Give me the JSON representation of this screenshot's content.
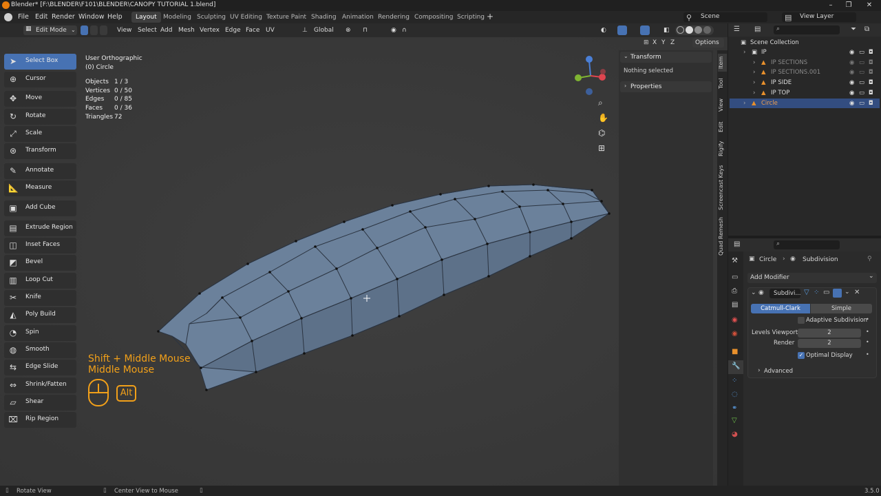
{
  "window": {
    "title": "Blender* [F:\\BLENDER\\F101\\BLENDER\\CANOPY TUTORIAL 1.blend]",
    "minimize": "–",
    "maximize": "❐",
    "close": "✕"
  },
  "menu": [
    "File",
    "Edit",
    "Render",
    "Window",
    "Help"
  ],
  "workspaces": [
    "Layout",
    "Modeling",
    "Sculpting",
    "UV Editing",
    "Texture Paint",
    "Shading",
    "Animation",
    "Rendering",
    "Compositing",
    "Scripting"
  ],
  "add_workspace": "+",
  "scene": {
    "name": "Scene",
    "view_layer": "View Layer"
  },
  "header": {
    "mode": "Edit Mode",
    "menus": [
      "View",
      "Select",
      "Add",
      "Mesh",
      "Vertex",
      "Edge",
      "Face",
      "UV"
    ],
    "orientation": "Global",
    "options": "Options",
    "axes": [
      "X",
      "Y",
      "Z"
    ]
  },
  "toolbar": [
    {
      "label": "Select Box",
      "icon": "select-box-icon",
      "glyph": "➤",
      "active": true
    },
    {
      "label": "Cursor",
      "icon": "cursor-icon",
      "glyph": "⊕"
    },
    {
      "label": "Move",
      "icon": "move-icon",
      "glyph": "✥"
    },
    {
      "label": "Rotate",
      "icon": "rotate-icon",
      "glyph": "↻"
    },
    {
      "label": "Scale",
      "icon": "scale-icon",
      "glyph": "⤢"
    },
    {
      "label": "Transform",
      "icon": "transform-icon",
      "glyph": "⊛"
    },
    {
      "label": "Annotate",
      "icon": "annotate-icon",
      "glyph": "✎"
    },
    {
      "label": "Measure",
      "icon": "measure-icon",
      "glyph": "📐"
    },
    {
      "label": "Add Cube",
      "icon": "add-cube-icon",
      "glyph": "▣"
    },
    {
      "label": "Extrude Region",
      "icon": "extrude-region-icon",
      "glyph": "▤"
    },
    {
      "label": "Inset Faces",
      "icon": "inset-faces-icon",
      "glyph": "◫"
    },
    {
      "label": "Bevel",
      "icon": "bevel-icon",
      "glyph": "◩"
    },
    {
      "label": "Loop Cut",
      "icon": "loop-cut-icon",
      "glyph": "▥"
    },
    {
      "label": "Knife",
      "icon": "knife-icon",
      "glyph": "✂"
    },
    {
      "label": "Poly Build",
      "icon": "poly-build-icon",
      "glyph": "◭"
    },
    {
      "label": "Spin",
      "icon": "spin-icon",
      "glyph": "◔"
    },
    {
      "label": "Smooth",
      "icon": "smooth-icon",
      "glyph": "◍"
    },
    {
      "label": "Edge Slide",
      "icon": "edge-slide-icon",
      "glyph": "⇆"
    },
    {
      "label": "Shrink/Fatten",
      "icon": "shrink-fatten-icon",
      "glyph": "⇔"
    },
    {
      "label": "Shear",
      "icon": "shear-icon",
      "glyph": "▱"
    },
    {
      "label": "Rip Region",
      "icon": "rip-region-icon",
      "glyph": "⌧"
    }
  ],
  "viewport": {
    "view_name": "User Orthographic",
    "object_name": "(0) Circle",
    "stats": [
      {
        "label": "Objects",
        "value": "1 / 3"
      },
      {
        "label": "Vertices",
        "value": "0 / 50"
      },
      {
        "label": "Edges",
        "value": "0 / 85"
      },
      {
        "label": "Faces",
        "value": "0 / 36"
      },
      {
        "label": "Triangles",
        "value": "72"
      }
    ],
    "shortcut_line1": "Shift + Middle Mouse",
    "shortcut_line2": "Middle Mouse",
    "alt_key": "Alt"
  },
  "npanel": {
    "transform": "Transform",
    "nothing_selected": "Nothing selected",
    "properties": "Properties",
    "tabs": [
      "Item",
      "Tool",
      "View",
      "Edit",
      "Rigify",
      "Screencast Keys",
      "Quad Remesh"
    ]
  },
  "outliner": {
    "root": "Scene Collection",
    "rows": [
      {
        "name": "IP",
        "level": 1
      },
      {
        "name": "IP SECTIONS",
        "level": 2,
        "dim": true
      },
      {
        "name": "IP SECTIONS.001",
        "level": 2,
        "dim": true
      },
      {
        "name": "IP SIDE",
        "level": 2
      },
      {
        "name": "IP TOP",
        "level": 2
      },
      {
        "name": "Circle",
        "level": 1,
        "selected": true
      }
    ]
  },
  "properties": {
    "object": "Circle",
    "modifier_path": "Subdivision",
    "add_modifier": "Add Modifier",
    "modifier_name": "Subdivi...",
    "catmull": "Catmull-Clark",
    "simple": "Simple",
    "adaptive": "Adaptive Subdivision",
    "levels_viewport_label": "Levels Viewport",
    "levels_viewport_value": "2",
    "render_label": "Render",
    "render_value": "2",
    "optimal": "Optimal Display",
    "advanced": "Advanced"
  },
  "status": {
    "rotate_view": "Rotate View",
    "center_view": "Center View to Mouse",
    "version": "3.5.0"
  },
  "colors": {
    "accent": "#4772b3",
    "overlay": "#f2a019",
    "mesh_face": "#6c829c",
    "selection": "#e87d0d"
  }
}
